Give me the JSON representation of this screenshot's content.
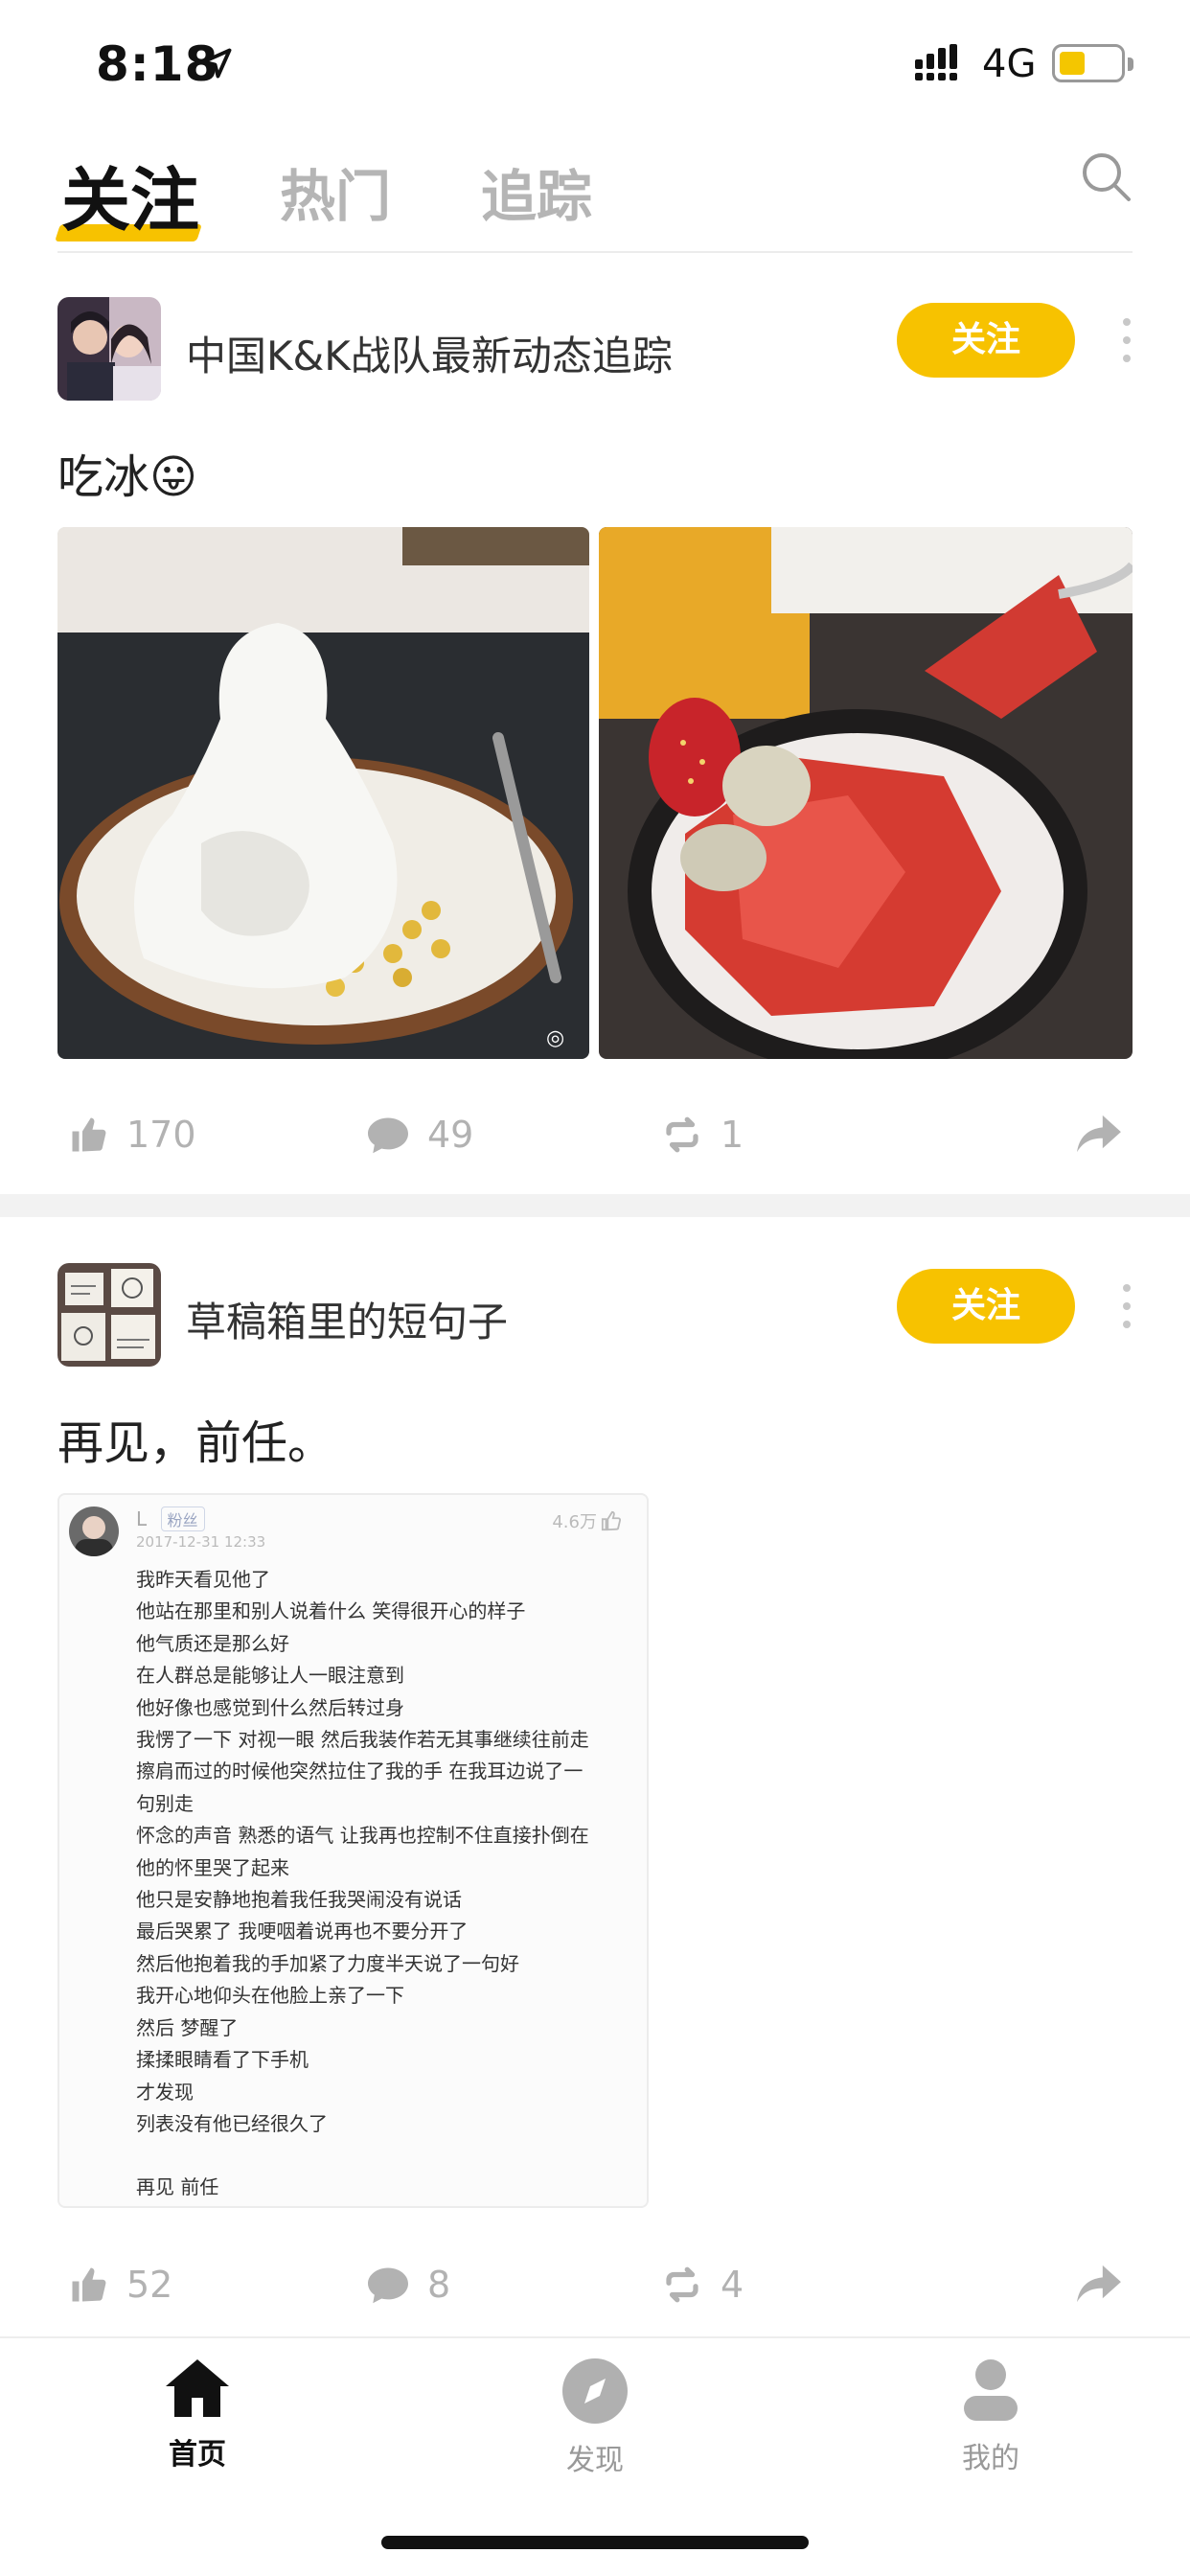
{
  "status_bar": {
    "time": "8:18",
    "network": "4G"
  },
  "tabs": [
    {
      "label": "关注",
      "active": true
    },
    {
      "label": "热门",
      "active": false
    },
    {
      "label": "追踪",
      "active": false
    }
  ],
  "posts": [
    {
      "author": "中国K&K战队最新动态追踪",
      "follow_label": "关注",
      "text": "吃冰",
      "emoji": "😛",
      "stats": {
        "likes": "170",
        "comments": "49",
        "reposts": "1"
      }
    },
    {
      "author": "草稿箱里的短句子",
      "follow_label": "关注",
      "text": "再见，前任。",
      "screenshot": {
        "user": "L",
        "tag": "粉丝",
        "date": "2017-12-31 12:33",
        "likes": "4.6万",
        "lines": [
          "我昨天看见他了",
          "他站在那里和别人说着什么 笑得很开心的样子",
          "他气质还是那么好",
          "在人群总是能够让人一眼注意到",
          "他好像也感觉到什么然后转过身",
          "我愣了一下 对视一眼 然后我装作若无其事继续往前走",
          "擦肩而过的时候他突然拉住了我的手 在我耳边说了一",
          "句别走",
          "怀念的声音 熟悉的语气 让我再也控制不住直接扑倒在",
          "他的怀里哭了起来",
          "他只是安静地抱着我任我哭闹没有说话",
          "最后哭累了 我哽咽着说再也不要分开了",
          "然后他抱着我的手加紧了力度半天说了一句好",
          "我开心地仰头在他脸上亲了一下",
          "然后 梦醒了",
          "揉揉眼睛看了下手机",
          "才发现",
          "列表没有他已经很久了",
          "",
          "再见 前任"
        ]
      },
      "stats": {
        "likes": "52",
        "comments": "8",
        "reposts": "4"
      }
    }
  ],
  "bottom_nav": [
    {
      "label": "首页",
      "icon": "home-icon",
      "active": true
    },
    {
      "label": "发现",
      "icon": "compass-icon",
      "active": false
    },
    {
      "label": "我的",
      "icon": "profile-icon",
      "active": false
    }
  ],
  "colors": {
    "accent": "#f7c200",
    "muted": "#b2b2b2"
  }
}
